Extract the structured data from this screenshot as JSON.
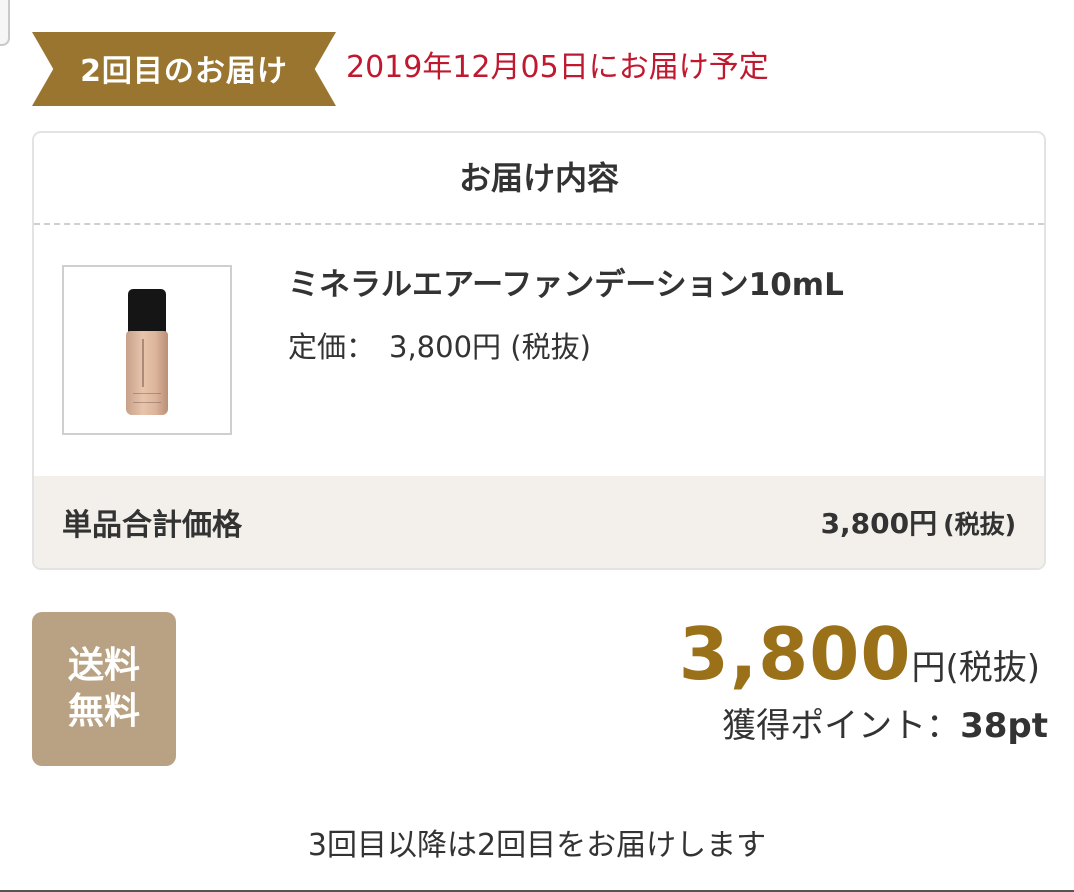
{
  "delivery": {
    "ribbon_label": "2回目のお届け",
    "scheduled_date": "2019年12月05日にお届け予定"
  },
  "card": {
    "title": "お届け内容",
    "product": {
      "name": "ミネラルエアーファンデーション10mL",
      "price_label": "定価：",
      "price_value": "3,800円",
      "price_tax": "(税抜)"
    },
    "subtotal": {
      "label": "単品合計価格",
      "value": "3,800円",
      "tax": "(税抜)"
    }
  },
  "shipping_badge": {
    "line1": "送料",
    "line2": "無料"
  },
  "total": {
    "amount": "3,800",
    "unit": "円(税抜)"
  },
  "points": {
    "label": "獲得ポイント：",
    "value": "38pt"
  },
  "next_delivery_note": "3回目以降は2回目をお届けします",
  "colors": {
    "ribbon": "#9a7530",
    "date_red": "#c0182f",
    "total_gold": "#9a7018",
    "badge_tan": "#b8a283",
    "subtotal_bg": "#f3f0ec"
  }
}
